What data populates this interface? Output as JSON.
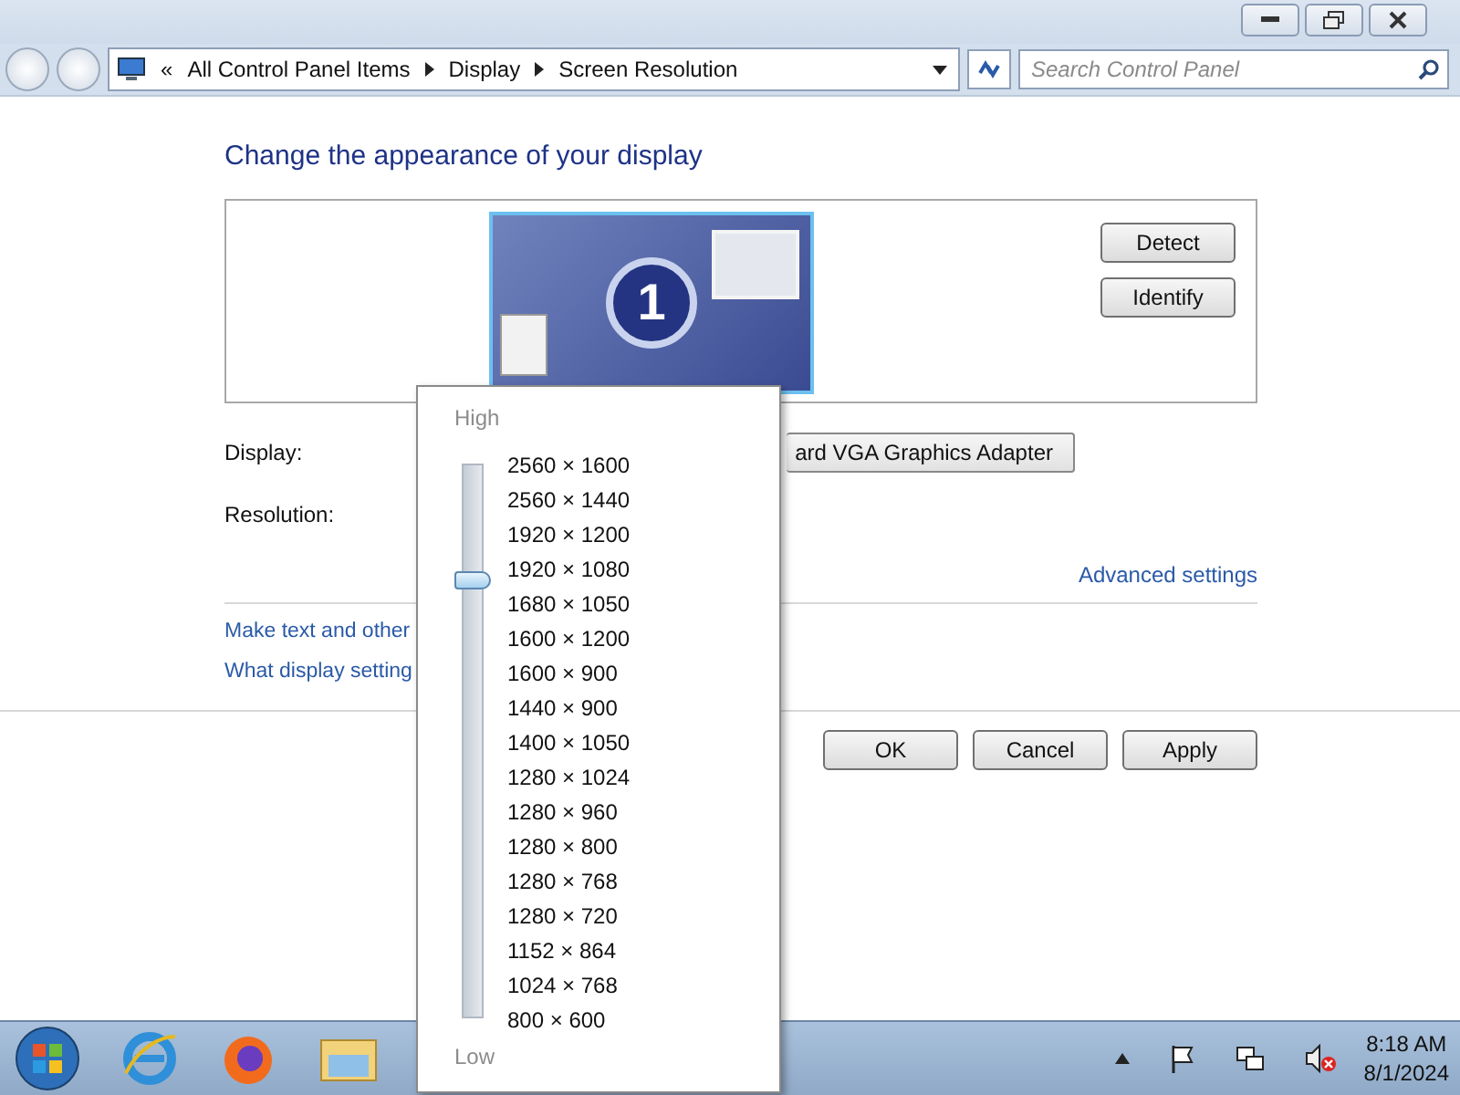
{
  "address_bar": {
    "chevron": "«",
    "crumbs": [
      "All Control Panel Items",
      "Display",
      "Screen Resolution"
    ]
  },
  "search": {
    "placeholder": "Search Control Panel"
  },
  "heading": "Change the appearance of your display",
  "monitor": {
    "number": "1"
  },
  "side_buttons": [
    "Detect",
    "Identify"
  ],
  "display_row": {
    "label": "Display:",
    "value": "ard VGA Graphics Adapter"
  },
  "resolution_row": {
    "label": "Resolution:"
  },
  "advanced_link": "Advanced settings",
  "links": [
    "Make text and other",
    "What display setting"
  ],
  "footer_buttons": [
    "OK",
    "Cancel",
    "Apply"
  ],
  "resolution_popup": {
    "high": "High",
    "low": "Low",
    "level": 0.8,
    "options": [
      "2560 × 1600",
      "2560 × 1440",
      "1920 × 1200",
      "1920 × 1080",
      "1680 × 1050",
      "1600 × 1200",
      "1600 × 900",
      "1440 × 900",
      "1400 × 1050",
      "1280 × 1024",
      "1280 × 960",
      "1280 × 800",
      "1280 × 768",
      "1280 × 720",
      "1152 × 864",
      "1024 × 768",
      "800 × 600"
    ]
  },
  "clock": {
    "time": "8:18 AM",
    "date": "8/1/2024"
  }
}
